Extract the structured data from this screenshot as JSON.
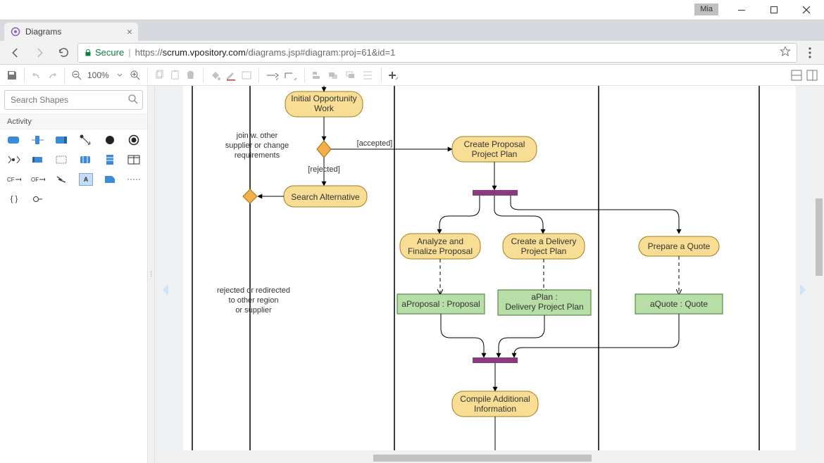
{
  "window": {
    "user_tag": "Mia"
  },
  "browser": {
    "tab_title": "Diagrams",
    "secure_label": "Secure",
    "url_prefix": "https://",
    "url_host": "scrum.vpository.com",
    "url_path": "/diagrams.jsp#diagram:proj=61&id=1"
  },
  "toolbar": {
    "zoom_label": "100%"
  },
  "sidebar": {
    "search_placeholder": "Search Shapes",
    "palette_title": "Activity",
    "cf_label": "CF",
    "of_label": "OF",
    "braces_label": "{ }"
  },
  "diagram": {
    "initial_opportunity_1": "Initial Opportunity",
    "initial_opportunity_2": "Work",
    "join_note_1": "join w. other",
    "join_note_2": "supplier or change",
    "join_note_3": "requirements",
    "accepted": "[accepted]",
    "rejected": "[rejected]",
    "search_alternative": "Search Alternative",
    "redirect_note_1": "rejected or redirected",
    "redirect_note_2": "to other region",
    "redirect_note_3": "or supplier",
    "create_proposal_1": "Create Proposal",
    "create_proposal_2": "Project Plan",
    "analyze_1": "Analyze and",
    "analyze_2": "Finalize Proposal",
    "create_delivery_1": "Create a Delivery",
    "create_delivery_2": "Project Plan",
    "prepare_quote": "Prepare a Quote",
    "aProposal": "aProposal : Proposal",
    "aPlan_1": "aPlan :",
    "aPlan_2": "Delivery Project Plan",
    "aQuote": "aQuote : Quote",
    "compile_1": "Compile Additional",
    "compile_2": "Information"
  }
}
